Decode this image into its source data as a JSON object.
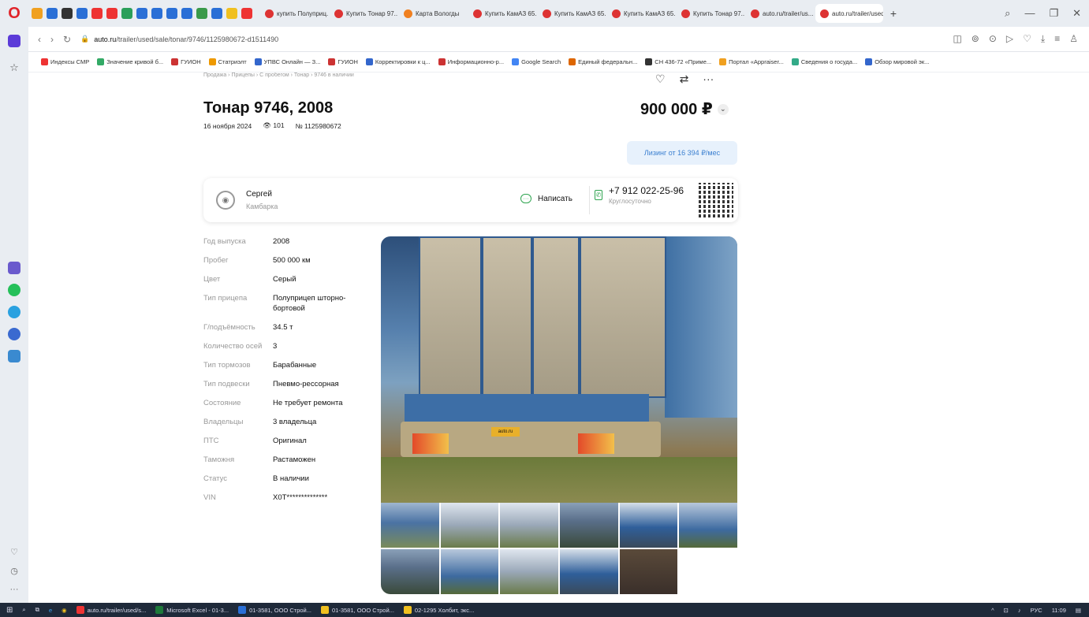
{
  "browser": {
    "tabs": [
      {
        "label": "купить Полуприц..."
      },
      {
        "label": "Купить Тонар 97..."
      },
      {
        "label": "Карта Вологды"
      },
      {
        "label": "Купить КамАЗ 65..."
      },
      {
        "label": "Купить КамАЗ 65..."
      },
      {
        "label": "Купить КамАЗ 65..."
      },
      {
        "label": "Купить Тонар 97..."
      },
      {
        "label": "auto.ru/trailer/us..."
      },
      {
        "label": "auto.ru/trailer/used/sale/..."
      }
    ],
    "url_domain": "auto.ru",
    "url_path": "/trailer/used/sale/tonar/9746/1125980672-d1511490",
    "bookmarks": [
      "Индексы СМР",
      "Значение кривой б...",
      "ГУИОН",
      "Статриэлт",
      "УПВС Онлайн — З...",
      "ГУИОН",
      "Корректировки к ц...",
      "Информационно-р...",
      "Google Search",
      "Единый федеральн...",
      "СН 436-72 «Приме...",
      "Портал «Appraiser...",
      "Сведения о госуда...",
      "Обзор мировой эк..."
    ]
  },
  "listing": {
    "breadcrumb": "Продажа › Прицепы › С пробегом › Тонар › 9746 в наличии",
    "title": "Тонар 9746, 2008",
    "date": "16 ноября 2024",
    "views": "101",
    "number": "№ 1125980672",
    "price": "900 000 ₽",
    "leasing": "Лизинг от 16 394 ₽/мес"
  },
  "seller": {
    "name": "Сергей",
    "city": "Камбарка",
    "write_label": "Написать",
    "phone": "+7 912 022-25-96",
    "hours": "Круглосуточно"
  },
  "specs": [
    {
      "k": "Год выпуска",
      "v": "2008"
    },
    {
      "k": "Пробег",
      "v": "500 000 км"
    },
    {
      "k": "Цвет",
      "v": "Серый"
    },
    {
      "k": "Тип прицепа",
      "v": "Полуприцеп шторно-бортовой"
    },
    {
      "k": "Г/подъёмность",
      "v": "34.5 т"
    },
    {
      "k": "Количество осей",
      "v": "3"
    },
    {
      "k": "Тип тормозов",
      "v": "Барабанные"
    },
    {
      "k": "Тип подвески",
      "v": "Пневмо-рессорная"
    },
    {
      "k": "Состояние",
      "v": "Не требует ремонта"
    },
    {
      "k": "Владельцы",
      "v": "3 владельца"
    },
    {
      "k": "ПТС",
      "v": "Оригинал"
    },
    {
      "k": "Таможня",
      "v": "Растаможен"
    },
    {
      "k": "Статус",
      "v": "В наличии"
    },
    {
      "k": "VIN",
      "v": "X0T**************"
    }
  ],
  "plate_text": "auto.ru",
  "taskbar": {
    "items": [
      "auto.ru/trailer/used/s...",
      "Microsoft Excel - 01-3...",
      "01-3581, ООО Строй...",
      "01-3581, ООО Строй...",
      "02-1295 Холбит, экс..."
    ],
    "lang": "РУС",
    "time": "11:09"
  }
}
